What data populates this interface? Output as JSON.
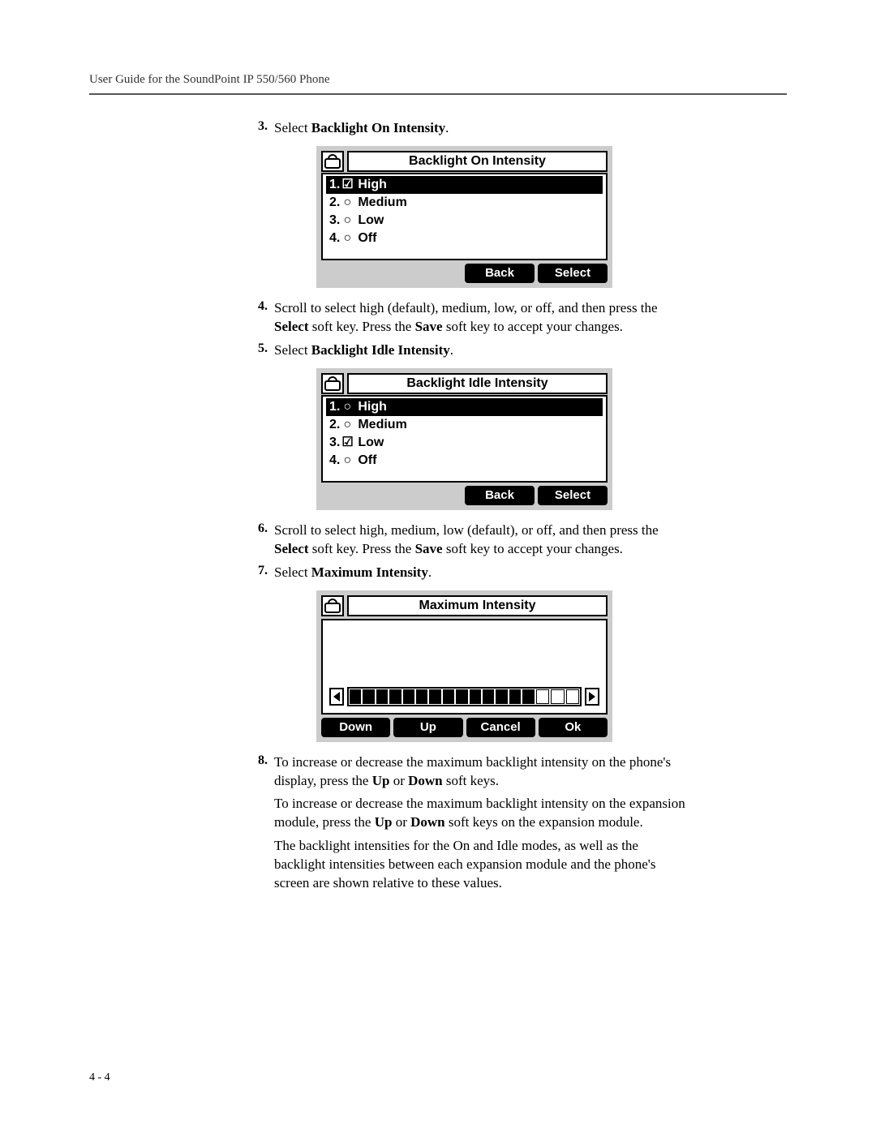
{
  "header": "User Guide for the SoundPoint IP 550/560 Phone",
  "page_num": "4 - 4",
  "steps": {
    "s3": {
      "num": "3.",
      "pre": "Select ",
      "bold": "Backlight On Intensity",
      "post": "."
    },
    "s4": {
      "num": "4.",
      "text_a": "Scroll to select high (default), medium, low, or off, and then press the ",
      "b1": "Select",
      "text_b": " soft key. Press the ",
      "b2": "Save",
      "text_c": " soft key to accept your changes."
    },
    "s5": {
      "num": "5.",
      "pre": "Select ",
      "bold": "Backlight Idle Intensity",
      "post": "."
    },
    "s6": {
      "num": "6.",
      "text_a": "Scroll to select high, medium, low (default), or off, and then press the ",
      "b1": "Select",
      "text_b": " soft key. Press the ",
      "b2": "Save",
      "text_c": " soft key to accept your changes."
    },
    "s7": {
      "num": "7.",
      "pre": "Select ",
      "bold": "Maximum Intensity",
      "post": "."
    },
    "s8": {
      "num": "8.",
      "text_a": "To increase or decrease the maximum backlight intensity on the phone's display, press the ",
      "b1": "Up",
      "text_b": " or ",
      "b2": "Down",
      "text_c": " soft keys."
    },
    "s8p2": {
      "text_a": "To increase or decrease the maximum backlight intensity on the expansion module, press the ",
      "b1": "Up",
      "text_b": " or ",
      "b2": "Down",
      "text_c": " soft keys on the expansion module."
    },
    "s8p3": "The backlight intensities for the On and Idle modes, as well as the backlight intensities between each expansion module and the phone's screen are shown relative to these values."
  },
  "lcd1": {
    "title": "Backlight On Intensity",
    "items": [
      {
        "num": "1.",
        "checked": true,
        "label": "High",
        "selected": true
      },
      {
        "num": "2.",
        "checked": false,
        "label": "Medium",
        "selected": false
      },
      {
        "num": "3.",
        "checked": false,
        "label": "Low",
        "selected": false
      },
      {
        "num": "4.",
        "checked": false,
        "label": "Off",
        "selected": false
      }
    ],
    "softkeys": {
      "back": "Back",
      "select": "Select"
    }
  },
  "lcd2": {
    "title": "Backlight Idle Intensity",
    "items": [
      {
        "num": "1.",
        "checked": false,
        "label": "High",
        "selected": true
      },
      {
        "num": "2.",
        "checked": false,
        "label": "Medium",
        "selected": false
      },
      {
        "num": "3.",
        "checked": true,
        "label": "Low",
        "selected": false
      },
      {
        "num": "4.",
        "checked": false,
        "label": "Off",
        "selected": false
      }
    ],
    "softkeys": {
      "back": "Back",
      "select": "Select"
    }
  },
  "lcd3": {
    "title": "Maximum Intensity",
    "filled_segments": 14,
    "total_segments": 17,
    "softkeys": {
      "down": "Down",
      "up": "Up",
      "cancel": "Cancel",
      "ok": "Ok"
    }
  }
}
